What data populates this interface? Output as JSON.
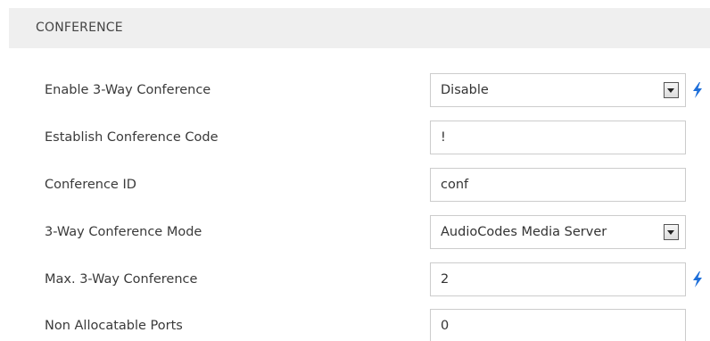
{
  "section": {
    "title": "CONFERENCE"
  },
  "fields": [
    {
      "label": "Enable 3-Way Conference",
      "value": "Disable",
      "type": "select",
      "has_bolt": true
    },
    {
      "label": "Establish Conference Code",
      "value": "!",
      "type": "text",
      "has_bolt": false
    },
    {
      "label": "Conference ID",
      "value": "conf",
      "type": "text",
      "has_bolt": false
    },
    {
      "label": "3-Way Conference Mode",
      "value": "AudioCodes Media Server",
      "type": "select",
      "has_bolt": false
    },
    {
      "label": "Max. 3-Way Conference",
      "value": "2",
      "type": "text",
      "has_bolt": true
    },
    {
      "label": "Non Allocatable Ports",
      "value": "0",
      "type": "text",
      "has_bolt": false
    }
  ],
  "icons": {
    "bolt": "lightning-bolt-icon",
    "dropdown": "chevron-down-icon"
  },
  "colors": {
    "header_bg": "#efefef",
    "bolt": "#1e6fd9",
    "field_border": "#cccccc"
  }
}
